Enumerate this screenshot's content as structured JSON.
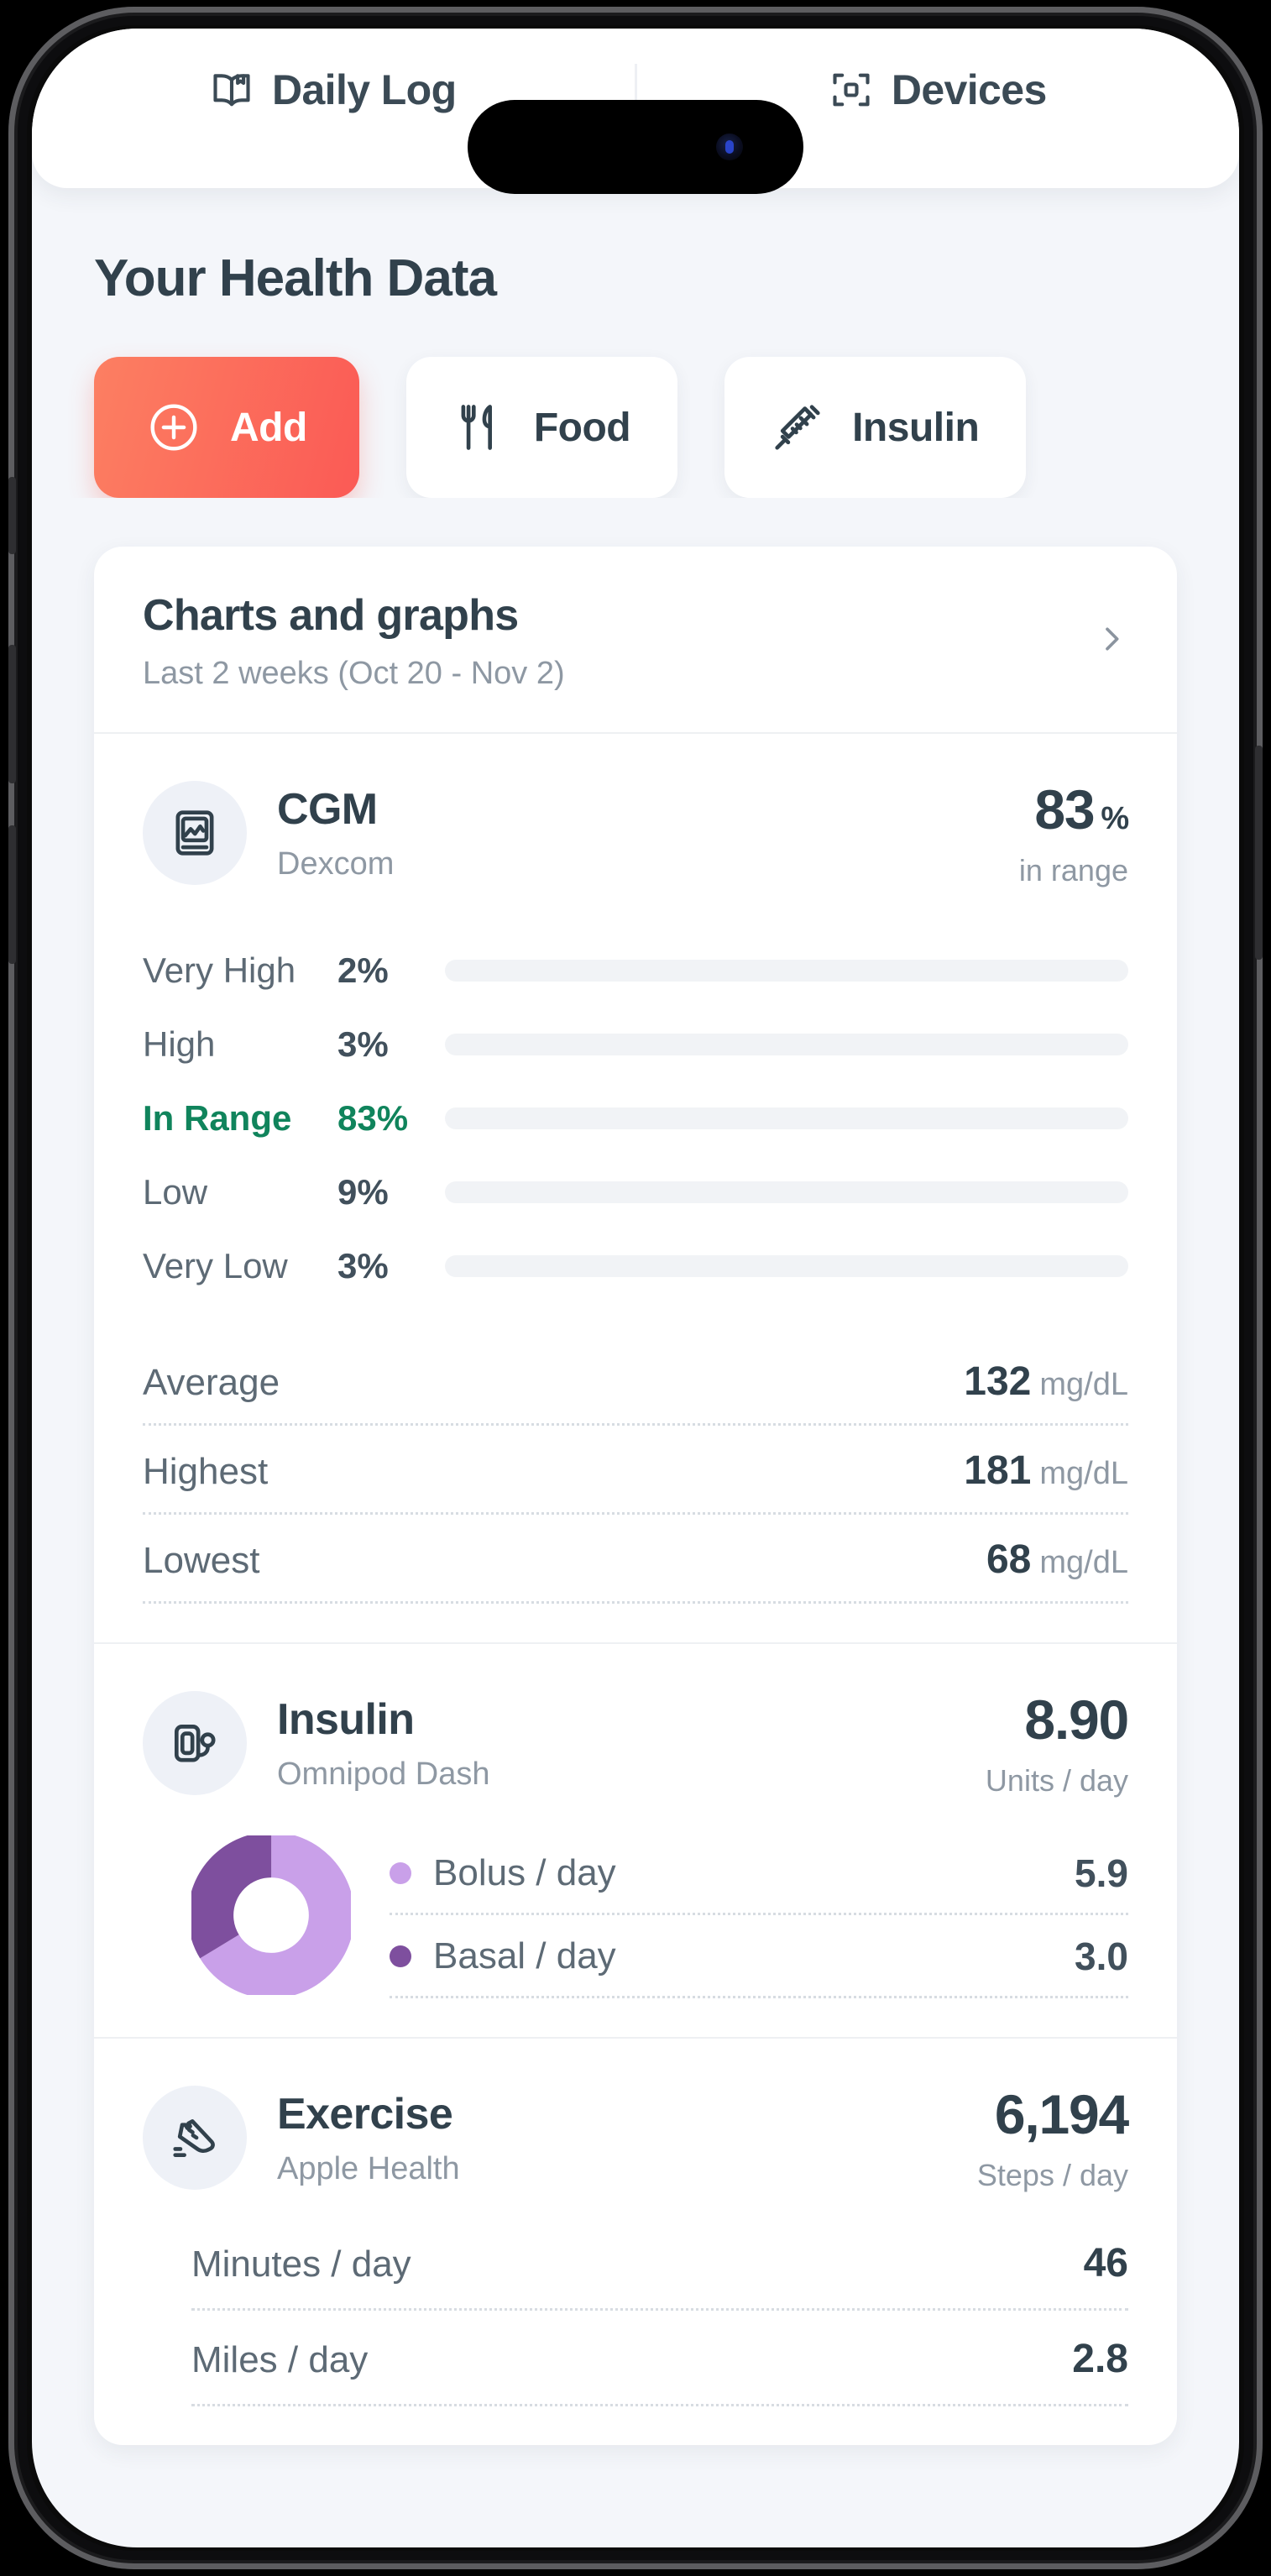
{
  "tabs": [
    {
      "label": "Daily Log",
      "icon": "book-open-icon",
      "active": true
    },
    {
      "label": "Devices",
      "icon": "devices-icon",
      "active": false
    }
  ],
  "page_title": "Your Health Data",
  "actions": [
    {
      "label": "Add",
      "icon": "plus-circle-icon",
      "style": "primary"
    },
    {
      "label": "Food",
      "icon": "fork-knife-icon",
      "style": "default"
    },
    {
      "label": "Insulin",
      "icon": "syringe-icon",
      "style": "default"
    }
  ],
  "charts_card": {
    "title": "Charts and graphs",
    "subtitle": "Last 2 weeks (Oct 20 - Nov 2)",
    "chevron": "chevron-right-icon"
  },
  "cgm": {
    "icon": "cgm-monitor-icon",
    "name": "CGM",
    "source": "Dexcom",
    "value": "83",
    "value_suffix": "%",
    "value_caption": "in range",
    "stats": [
      {
        "key": "Average",
        "value": "132",
        "unit": "mg/dL"
      },
      {
        "key": "Highest",
        "value": "181",
        "unit": "mg/dL"
      },
      {
        "key": "Lowest",
        "value": "68",
        "unit": "mg/dL"
      }
    ]
  },
  "insulin": {
    "icon": "insulin-pump-icon",
    "name": "Insulin",
    "source": "Omnipod Dash",
    "value": "8.90",
    "value_caption": "Units / day",
    "breakdown": [
      {
        "label": "Bolus / day",
        "value": "5.9",
        "color": "#c9a0e9"
      },
      {
        "label": "Basal / day",
        "value": "3.0",
        "color": "#7e4f9e"
      }
    ]
  },
  "exercise": {
    "icon": "running-shoe-icon",
    "name": "Exercise",
    "source": "Apple Health",
    "value": "6,194",
    "value_caption": "Steps / day",
    "stats": [
      {
        "key": "Minutes / day",
        "value": "46"
      },
      {
        "key": "Miles / day",
        "value": "2.8"
      }
    ]
  },
  "chart_data": [
    {
      "type": "bar",
      "title": "CGM time in range distribution",
      "orientation": "horizontal",
      "categories": [
        "Very High",
        "High",
        "In Range",
        "Low",
        "Very Low"
      ],
      "values": [
        2,
        3,
        83,
        9,
        3
      ],
      "value_labels": [
        "2%",
        "3%",
        "83%",
        "9%",
        "3%"
      ],
      "colors": [
        "#f9813f",
        "#fbcf4e",
        "#3ddca0",
        "#f97bb4",
        "#f8555b"
      ],
      "track_color": "#f1f3f6",
      "xlabel": "",
      "ylabel": "",
      "xlim": [
        0,
        100
      ],
      "grid": false,
      "legend": false,
      "highlight_category": "In Range"
    },
    {
      "type": "pie",
      "subtype": "donut",
      "title": "Insulin delivery split",
      "labels": [
        "Bolus / day",
        "Basal / day"
      ],
      "values": [
        5.9,
        3.0
      ],
      "units": "Units / day",
      "total": 8.9,
      "colors": [
        "#c9a0e9",
        "#7e4f9e"
      ],
      "legend": true,
      "legend_position": "right"
    }
  ],
  "colors": {
    "accent_start": "#fc7f62",
    "accent_end": "#fb5a55",
    "text_dark": "#31414c",
    "text_muted": "#8e98a3",
    "in_range_green": "#10845c",
    "screen_bg": "#f4f6fa"
  }
}
